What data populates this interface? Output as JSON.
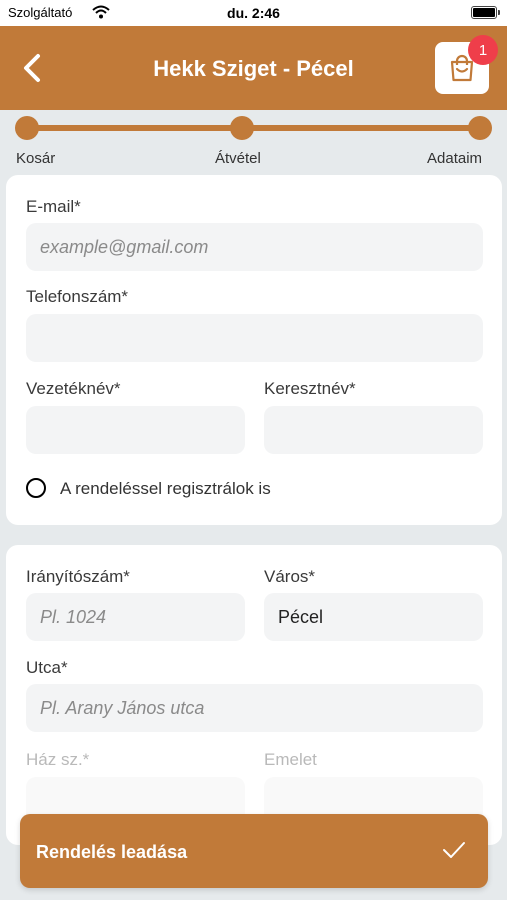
{
  "status_bar": {
    "carrier": "Szolgáltató",
    "time": "du. 2:46",
    "battery_level": 1.0
  },
  "header": {
    "title": "Hekk Sziget - Pécel",
    "back_icon": "chevron-left-icon",
    "cart_icon": "shopping-bag-icon",
    "cart_count": "1"
  },
  "stepper": {
    "steps": [
      "Kosár",
      "Átvétel",
      "Adataim"
    ],
    "active_step": 3
  },
  "contact_form": {
    "email_label": "E-mail*",
    "email_placeholder": "example@gmail.com",
    "email_value": "",
    "phone_label": "Telefonszám*",
    "phone_value": "",
    "lastname_label": "Vezetéknév*",
    "lastname_value": "",
    "firstname_label": "Keresztnév*",
    "firstname_value": "",
    "register_label": "A rendeléssel regisztrálok is",
    "register_checked": false
  },
  "address_form": {
    "zip_label": "Irányítószám*",
    "zip_placeholder": "Pl. 1024",
    "city_label": "Város*",
    "city_value": "Pécel",
    "street_label": "Utca*",
    "street_placeholder": "Pl. Arany János utca",
    "house_label": "Ház sz.*",
    "floor_label": "Emelet"
  },
  "submit": {
    "label": "Rendelés leadása",
    "icon": "checkmark-icon"
  },
  "colors": {
    "accent": "#c17a39",
    "badge": "#ef3e4a",
    "field_bg": "#f3f4f5",
    "page_bg": "#e6eaec"
  }
}
